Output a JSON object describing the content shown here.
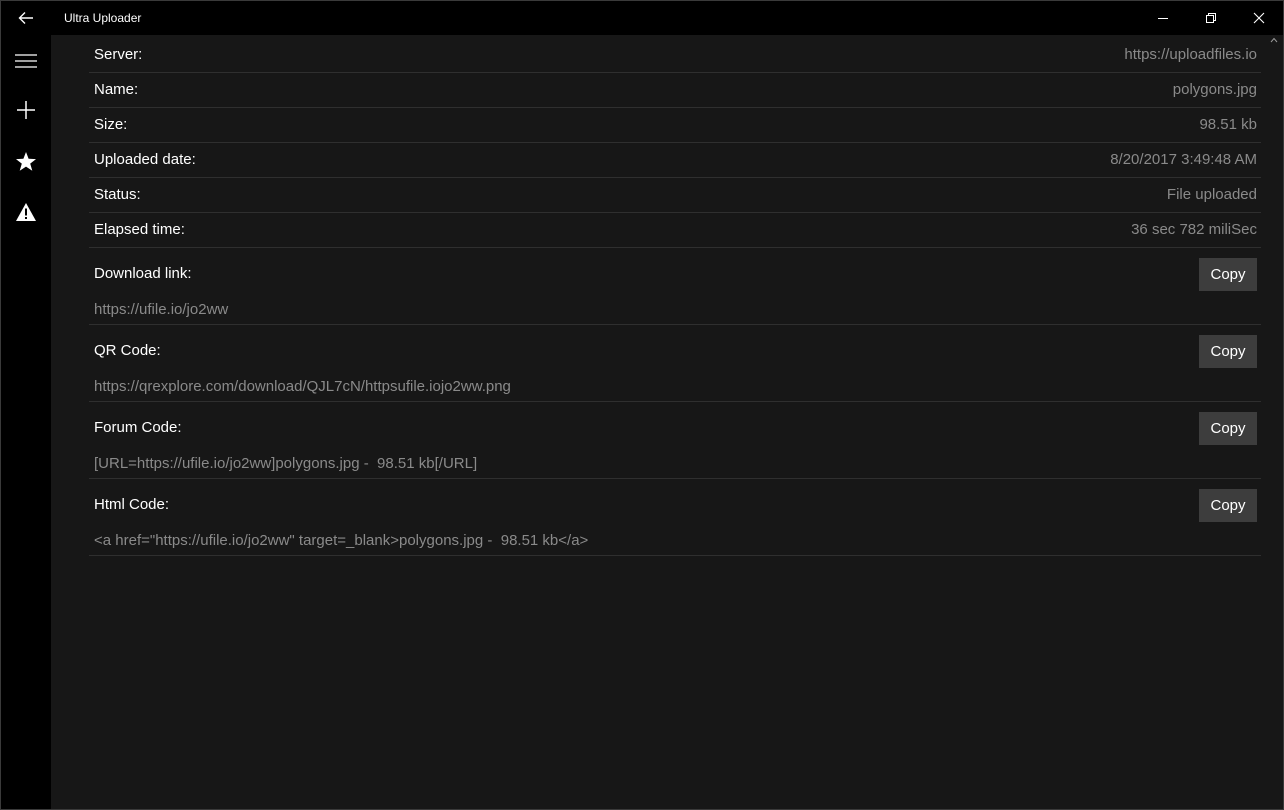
{
  "window": {
    "title": "Ultra Uploader"
  },
  "icons": {
    "back": "back-arrow-icon",
    "menu": "hamburger-icon",
    "add": "plus-icon",
    "favorites": "star-icon",
    "warning": "warning-icon",
    "minimize": "minimize-icon",
    "maximize": "maximize-icon",
    "close": "close-icon"
  },
  "details": [
    {
      "label": "Server:",
      "value": "https://uploadfiles.io"
    },
    {
      "label": "Name:",
      "value": "polygons.jpg"
    },
    {
      "label": "Size:",
      "value": "98.51 kb"
    },
    {
      "label": "Uploaded date:",
      "value": "8/20/2017 3:49:48 AM"
    },
    {
      "label": "Status:",
      "value": "File uploaded"
    },
    {
      "label": "Elapsed time:",
      "value": "36 sec 782 miliSec"
    }
  ],
  "codes": [
    {
      "label": "Download link:",
      "value": "https://ufile.io/jo2ww",
      "button": "Copy"
    },
    {
      "label": "QR Code:",
      "value": "https://qrexplore.com/download/QJL7cN/httpsufile.iojo2ww.png",
      "button": "Copy"
    },
    {
      "label": "Forum Code:",
      "value": "[URL=https://ufile.io/jo2ww]polygons.jpg -  98.51 kb[/URL]",
      "button": "Copy"
    },
    {
      "label": "Html Code:",
      "value": "<a href=\"https://ufile.io/jo2ww\" target=_blank>polygons.jpg -  98.51 kb</a>",
      "button": "Copy"
    }
  ],
  "colors": {
    "background": "#171717",
    "chrome": "#000000",
    "value_text": "#8a8a8a",
    "button_bg": "#3d3d3d"
  }
}
